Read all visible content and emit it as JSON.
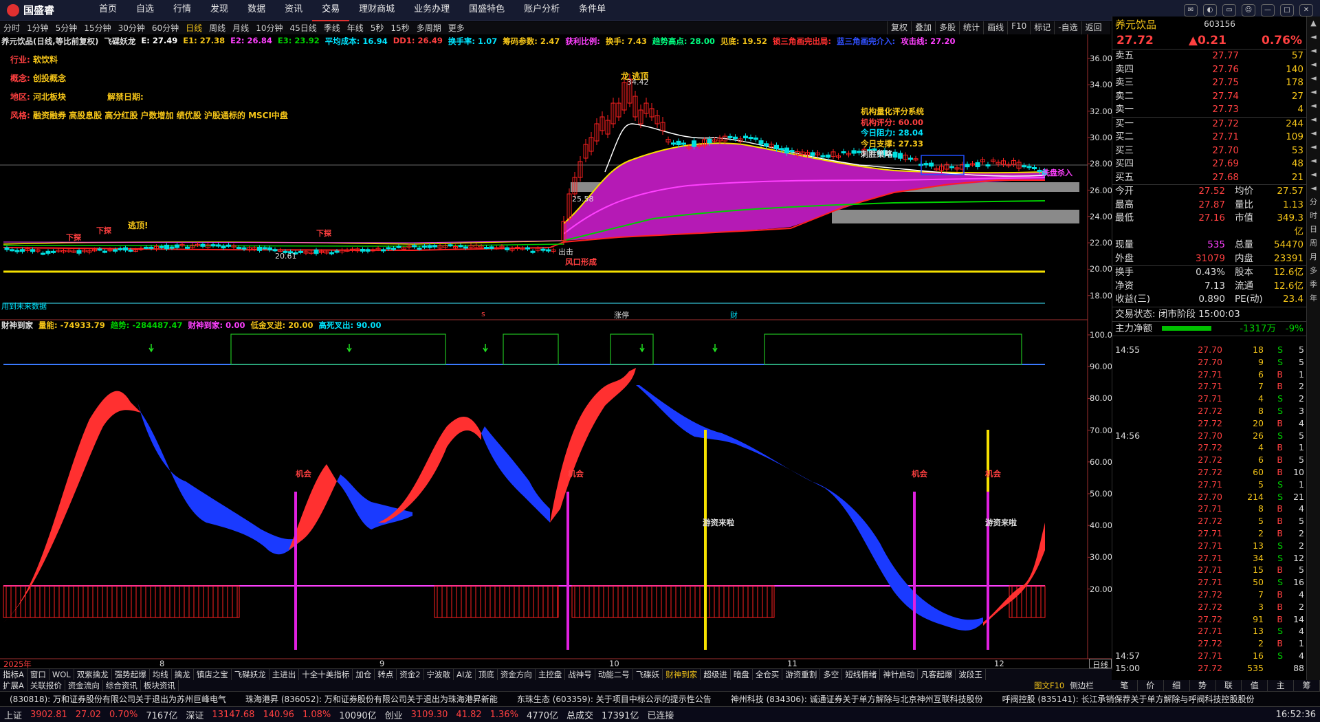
{
  "app": {
    "logo": "国盛睿"
  },
  "menu": [
    "首页",
    "自选",
    "行情",
    "发现",
    "数据",
    "资讯",
    "交易",
    "理财商城",
    "业务办理",
    "国盛特色",
    "账户分析",
    "条件单"
  ],
  "menu_active": "交易",
  "periods": [
    "分时",
    "1分钟",
    "5分钟",
    "15分钟",
    "30分钟",
    "60分钟",
    "日线",
    "周线",
    "月线",
    "10分钟",
    "45日线",
    "季线",
    "年线",
    "5秒",
    "15秒",
    "多周期",
    "更多"
  ],
  "period_active": "日线",
  "right_tools": [
    "复权",
    "叠加",
    "多股",
    "统计",
    "画线",
    "F10",
    "标记",
    "-自选",
    "返回"
  ],
  "header1": [
    {
      "t": "养元饮品(日线,等比前复权)",
      "c": "#ddd"
    },
    {
      "t": "飞碟妖龙",
      "c": "#ddd"
    },
    {
      "t": "E: 27.49",
      "c": "#fff"
    },
    {
      "t": "E1: 27.38",
      "c": "#f5c518"
    },
    {
      "t": "E2: 26.84",
      "c": "#ff40ff"
    },
    {
      "t": "E3: 23.92",
      "c": "#00d000"
    },
    {
      "t": "平均成本: 16.94",
      "c": "#00e5ff"
    },
    {
      "t": "DD1: 26.49",
      "c": "#ff4040"
    },
    {
      "t": "换手率: 1.07",
      "c": "#00e5ff"
    },
    {
      "t": "筹码参数: 2.47",
      "c": "#f5c518"
    },
    {
      "t": "获利比例:",
      "c": "#ff40ff"
    },
    {
      "t": "换手: 7.43",
      "c": "#f5c518"
    },
    {
      "t": "趋势高点: 28.00",
      "c": "#00ff80"
    },
    {
      "t": "见底: 19.52",
      "c": "#f5c518"
    },
    {
      "t": "锁三角画完出局:",
      "c": "#ff3030"
    },
    {
      "t": "蓝三角画完介入:",
      "c": "#3050ff"
    },
    {
      "t": "攻击线: 27.20",
      "c": "#ff40ff"
    }
  ],
  "info_lines": [
    {
      "k": "行业:",
      "v": "软饮料"
    },
    {
      "k": "概念:",
      "v": "创投概念"
    },
    {
      "k": "地区:",
      "v": "河北板块",
      "k2": "解禁日期:"
    },
    {
      "k": "风格:",
      "v": "融资融券 高股息股 高分红股 户数增加 绩优股 沪股通标的 MSCI中盘"
    }
  ],
  "score": {
    "title": "机构量化评分系统",
    "l1": "机构评分: 60.00",
    "l2": "今日阻力: 28.04",
    "l3": "今日支撑: 27.33",
    "l4": "刺胜策略"
  },
  "chart_labels": {
    "peak": "34.42",
    "longtop": "龙 逃顶",
    "low": "20.61",
    "mid": "25.58",
    "escape": "逃顶!",
    "wind": "风口形成",
    "s1": "下探",
    "s2": "下探",
    "s3": "下探",
    "atk": "出击",
    "xipan": "洗盘杀入",
    "future": "用到未来数据",
    "cai": "财",
    "zhang": "涨停",
    "s_tag": "s"
  },
  "price_axis": [
    "36.00",
    "34.00",
    "32.00",
    "30.00",
    "28.00",
    "26.00",
    "24.00",
    "22.00",
    "20.00",
    "18.00"
  ],
  "ind_axis": [
    "100.0",
    "90.00",
    "80.00",
    "70.00",
    "60.00",
    "50.00",
    "40.00",
    "30.00",
    "20.00"
  ],
  "header2": [
    {
      "t": "财神到家",
      "c": "#ddd"
    },
    {
      "t": "量能: -74933.79",
      "c": "#f5c518"
    },
    {
      "t": "趋势: -284487.47",
      "c": "#00d000"
    },
    {
      "t": "财神到家: 0.00",
      "c": "#ff40ff"
    },
    {
      "t": "低金叉进: 20.00",
      "c": "#f5c518"
    },
    {
      "t": "高死叉出: 90.00",
      "c": "#00e5ff"
    }
  ],
  "ind_labels": {
    "jihui": "机会",
    "youzi": "游资来啦"
  },
  "date_axis": [
    "2025年",
    "8",
    "9",
    "10",
    "11",
    "12"
  ],
  "period_box": "日线",
  "stock": {
    "name": "养元饮品",
    "code": "603156",
    "price": "27.72",
    "chg": "▲0.21",
    "pct": "0.76%"
  },
  "asks": [
    [
      "卖五",
      "27.77",
      "57"
    ],
    [
      "卖四",
      "27.76",
      "140"
    ],
    [
      "卖三",
      "27.75",
      "178"
    ],
    [
      "卖二",
      "27.74",
      "27"
    ],
    [
      "卖一",
      "27.73",
      "4"
    ]
  ],
  "bids": [
    [
      "买一",
      "27.72",
      "244"
    ],
    [
      "买二",
      "27.71",
      "109"
    ],
    [
      "买三",
      "27.70",
      "53"
    ],
    [
      "买四",
      "27.69",
      "48"
    ],
    [
      "买五",
      "27.68",
      "21"
    ]
  ],
  "stats": [
    [
      "今开",
      "27.52",
      "均价",
      "27.57"
    ],
    [
      "最高",
      "27.87",
      "量比",
      "1.13"
    ],
    [
      "最低",
      "27.16",
      "市值",
      "349.3亿"
    ],
    [
      "现量",
      "535",
      "总量",
      "54470"
    ],
    [
      "外盘",
      "31079",
      "内盘",
      "23391"
    ]
  ],
  "stats2": [
    [
      "换手",
      "0.43%",
      "股本",
      "12.6亿"
    ],
    [
      "净资",
      "7.13",
      "流通",
      "12.6亿"
    ],
    [
      "收益(三)",
      "0.890",
      "PE(动)",
      "23.4"
    ]
  ],
  "trade_state": "交易状态: 闭市阶段 15:00:03",
  "mainflow": {
    "label": "主力净额",
    "val": "-1317万",
    "pct": "-9%"
  },
  "ticks": [
    [
      "14:55",
      "27.70",
      "18",
      "S",
      "5"
    ],
    [
      "",
      "27.70",
      "9",
      "S",
      "5"
    ],
    [
      "",
      "27.71",
      "6",
      "B",
      "1"
    ],
    [
      "",
      "27.71",
      "7",
      "B",
      "2"
    ],
    [
      "",
      "27.71",
      "4",
      "S",
      "2"
    ],
    [
      "",
      "27.72",
      "8",
      "S",
      "3"
    ],
    [
      "",
      "27.72",
      "20",
      "B",
      "4"
    ],
    [
      "14:56",
      "27.70",
      "26",
      "S",
      "5"
    ],
    [
      "",
      "27.72",
      "4",
      "B",
      "1"
    ],
    [
      "",
      "27.72",
      "6",
      "B",
      "5"
    ],
    [
      "",
      "27.72",
      "60",
      "B",
      "10"
    ],
    [
      "",
      "27.71",
      "5",
      "S",
      "1"
    ],
    [
      "",
      "27.70",
      "214",
      "S",
      "21"
    ],
    [
      "",
      "27.71",
      "8",
      "B",
      "4"
    ],
    [
      "",
      "27.72",
      "5",
      "B",
      "5"
    ],
    [
      "",
      "27.71",
      "2",
      "B",
      "2"
    ],
    [
      "",
      "27.71",
      "13",
      "S",
      "2"
    ],
    [
      "",
      "27.71",
      "34",
      "S",
      "12"
    ],
    [
      "",
      "27.71",
      "15",
      "B",
      "5"
    ],
    [
      "",
      "27.71",
      "50",
      "S",
      "16"
    ],
    [
      "",
      "27.72",
      "7",
      "B",
      "4"
    ],
    [
      "",
      "27.72",
      "3",
      "B",
      "2"
    ],
    [
      "",
      "27.72",
      "91",
      "B",
      "14"
    ],
    [
      "",
      "27.71",
      "13",
      "S",
      "4"
    ],
    [
      "",
      "27.72",
      "2",
      "B",
      "1"
    ],
    [
      "14:57",
      "27.71",
      "16",
      "S",
      "4"
    ],
    [
      "15:00",
      "27.72",
      "535",
      "",
      "88"
    ]
  ],
  "side_buttons": [
    "分",
    "时",
    "日",
    "周",
    "月",
    "多",
    "季",
    "年"
  ],
  "idx_tabs": [
    "指标A",
    "窗口",
    "WOL",
    "双紫擒龙",
    "强势起爆",
    "均线",
    "擒龙",
    "镇店之宝",
    "飞碟妖龙",
    "主进出",
    "十全十美指标",
    "加仓",
    "转点",
    "资金2",
    "宁波敢",
    "AI龙",
    "顶底",
    "资金方向",
    "主控盘",
    "战神号",
    "动能二号",
    "飞碟妖",
    "财神到家",
    "超级进",
    "暗盘",
    "全仓买",
    "游资重割",
    "多空",
    "短线情绪",
    "神针启动",
    "凡客起爆",
    "波段王"
  ],
  "idx_active": "财神到家",
  "sub_tabs": [
    "扩展A",
    "关联报价",
    "资金流向",
    "综合资讯",
    "板块资讯"
  ],
  "r_tabs": [
    "笔",
    "价",
    "细",
    "势",
    "联",
    "值",
    "主",
    "筹"
  ],
  "r_top_tabs": [
    "图文F10",
    "侧边栏"
  ],
  "ticker": [
    "(830818): 万和证券股份有限公司关于退出为苏州巨峰电气",
    "珠海港昇 (836052): 万和证券股份有限公司关于退出为珠海港昇新能",
    "东珠生态 (603359): 关于项目中标公示的提示性公告",
    "神州科技 (834306): 诚通证券关于单方解除与北京神州互联科技股份",
    "呼阀控股 (835141): 长江承销保荐关于单方解除与呼阀科技控股股份"
  ],
  "status": {
    "sh_l": "上证",
    "sh_v": "3902.81",
    "sh_c": "27.02",
    "sh_p": "0.70%",
    "sh_a": "7167亿",
    "sz_l": "深证",
    "sz_v": "13147.68",
    "sz_c": "140.96",
    "sz_p": "1.08%",
    "sz_a": "10090亿",
    "cy_l": "创业",
    "cy_v": "3109.30",
    "cy_c": "41.82",
    "cy_p": "1.36%",
    "cy_a": "4770亿",
    "tot_l": "总成交",
    "tot_v": "17391亿",
    "conn": "已连接",
    "time": "16:52:36"
  }
}
